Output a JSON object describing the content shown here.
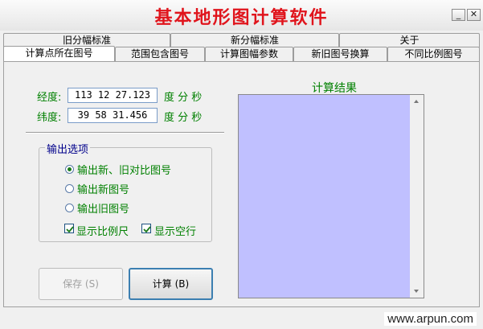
{
  "window": {
    "title": "基本地形图计算软件",
    "controls": {
      "minimize": "_",
      "close": "✕"
    }
  },
  "tabs": {
    "row_top": [
      "旧分幅标准",
      "新分幅标准",
      "关于"
    ],
    "row_bottom": [
      "计算点所在图号",
      "范围包含图号",
      "计算图幅参数",
      "新旧图号换算",
      "不同比例图号"
    ],
    "active": "计算点所在图号"
  },
  "form": {
    "longitude": {
      "label": "经度:",
      "value": "113 12 27.123",
      "units": "度 分 秒"
    },
    "latitude": {
      "label": "纬度:",
      "value": "39 58 31.456",
      "units": "度 分 秒"
    }
  },
  "output_options": {
    "title": "输出选项",
    "radios": [
      {
        "label": "输出新、旧对比图号",
        "checked": true
      },
      {
        "label": "输出新图号",
        "checked": false
      },
      {
        "label": "输出旧图号",
        "checked": false
      }
    ],
    "checkboxes": [
      {
        "label": "显示比例尺",
        "checked": true
      },
      {
        "label": "显示空行",
        "checked": true
      }
    ]
  },
  "buttons": {
    "save": "保存 (S)",
    "calculate": "计算 (B)"
  },
  "result": {
    "title": "计算结果",
    "background": "#c0c0ff"
  },
  "watermark": "www.arpun.com",
  "colors": {
    "title": "#e0141c",
    "label": "#008000",
    "group_title": "#00008b"
  }
}
